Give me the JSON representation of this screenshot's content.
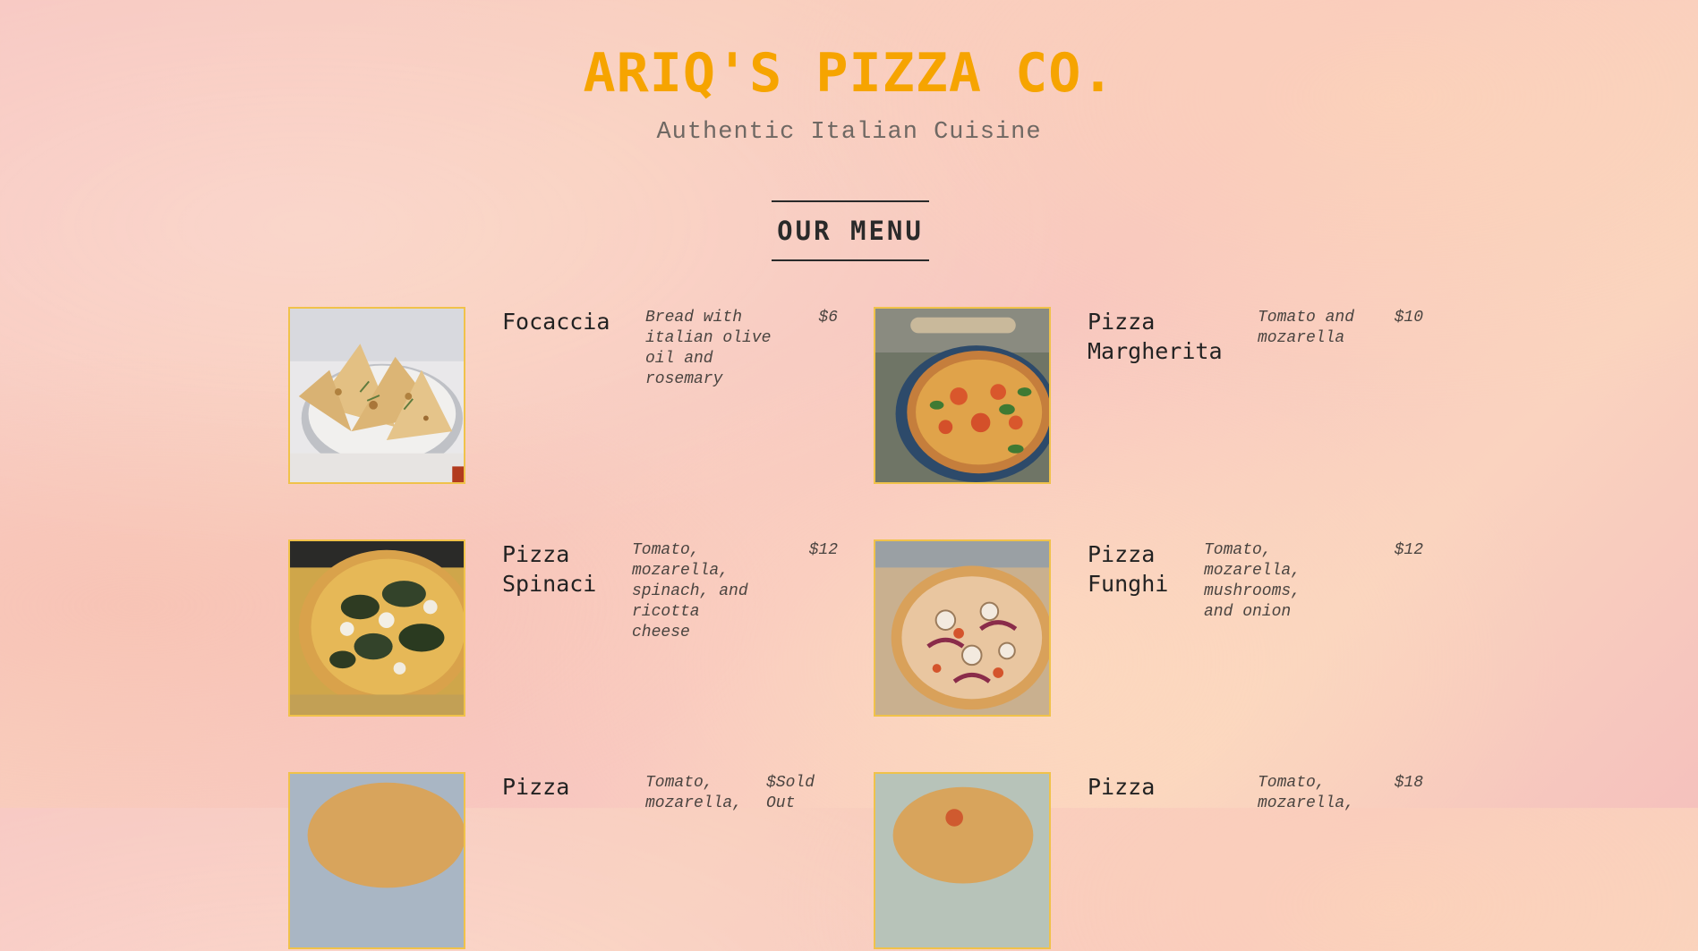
{
  "header": {
    "brand": "ARIQ'S PIZZA CO.",
    "tagline": "Authentic Italian Cuisine"
  },
  "menu": {
    "title": "OUR MENU",
    "items": [
      {
        "name": "Focaccia",
        "description": "Bread with italian olive oil and rosemary",
        "price": "$6",
        "image": "focaccia-photo"
      },
      {
        "name": "Pizza Margherita",
        "description": "Tomato and mozarella",
        "price": "$10",
        "image": "margherita-photo"
      },
      {
        "name": "Pizza Spinaci",
        "description": "Tomato, mozarella, spinach, and ricotta cheese",
        "price": "$12",
        "image": "spinaci-photo"
      },
      {
        "name": "Pizza Funghi",
        "description": "Tomato, mozarella, mushrooms, and onion",
        "price": "$12",
        "image": "funghi-photo"
      },
      {
        "name": "Pizza",
        "description": "Tomato, mozarella,",
        "price": "$Sold Out",
        "image": "pizza-photo"
      },
      {
        "name": "Pizza",
        "description": "Tomato, mozarella,",
        "price": "$18",
        "image": "pizza-photo"
      }
    ]
  },
  "colors": {
    "brand": "#f6a400",
    "photo_border": "#f0c24a",
    "text": "#2a2a2a",
    "muted": "#6f6863"
  }
}
